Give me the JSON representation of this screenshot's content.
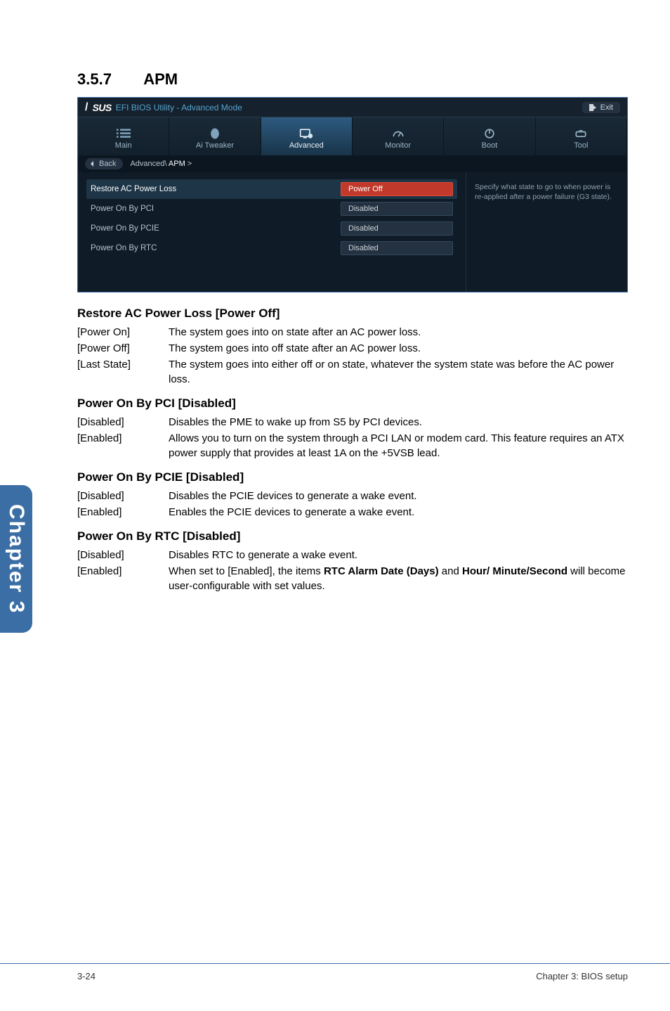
{
  "section": {
    "number": "3.5.7",
    "title": "APM"
  },
  "bios": {
    "brand_text": "SUS",
    "title_mode": "EFI BIOS Utility - Advanced Mode",
    "exit_label": "Exit",
    "tabs": [
      {
        "label": "Main"
      },
      {
        "label": "Ai  Tweaker"
      },
      {
        "label": "Advanced"
      },
      {
        "label": "Monitor"
      },
      {
        "label": "Boot"
      },
      {
        "label": "Tool"
      }
    ],
    "back_label": "Back",
    "breadcrumb_prefix": "Advanced\\ ",
    "breadcrumb_bold": "APM",
    "breadcrumb_suffix": " >",
    "settings": [
      {
        "label": "Restore AC Power Loss",
        "value": "Power Off",
        "highlight": true
      },
      {
        "label": "Power On By PCI",
        "value": "Disabled",
        "highlight": false
      },
      {
        "label": "Power On By PCIE",
        "value": "Disabled",
        "highlight": false
      },
      {
        "label": "Power On By RTC",
        "value": "Disabled",
        "highlight": false
      }
    ],
    "help_text": "Specify what state to go to when power is re-applied after a power failure (G3 state)."
  },
  "doc": {
    "items": [
      {
        "heading": "Restore AC Power Loss [Power Off]",
        "rows": [
          {
            "term": "[Power On]",
            "desc": "The system goes into on state after an AC power loss."
          },
          {
            "term": "[Power Off]",
            "desc": "The system goes into off state after an AC power loss."
          },
          {
            "term": "[Last State]",
            "desc": "The system goes into either off or on state, whatever the system state was before the AC power loss."
          }
        ]
      },
      {
        "heading": "Power On By PCI [Disabled]",
        "rows": [
          {
            "term": "[Disabled]",
            "desc": "Disables the PME to wake up from S5 by PCI devices."
          },
          {
            "term": "[Enabled]",
            "desc": "Allows you to turn on the system through a PCI LAN or modem card. This feature requires an ATX power supply that provides at least 1A on the +5VSB lead."
          }
        ]
      },
      {
        "heading": "Power On By PCIE [Disabled]",
        "rows": [
          {
            "term": "[Disabled]",
            "desc": "Disables the PCIE devices to generate a wake event."
          },
          {
            "term": "[Enabled]",
            "desc": "Enables the PCIE devices to generate a wake event."
          }
        ]
      },
      {
        "heading": "Power On By RTC [Disabled]",
        "rows": [
          {
            "term": "[Disabled]",
            "desc": "Disables RTC to generate a wake event."
          },
          {
            "term": "[Enabled]",
            "desc_html": "When set to [Enabled], the items <b>RTC Alarm Date (Days)</b> and <b>Hour/ Minute/Second</b> will become user-configurable with set values."
          }
        ]
      }
    ]
  },
  "sidebar": {
    "label": "Chapter 3"
  },
  "footer": {
    "left": "3-24",
    "right": "Chapter 3: BIOS setup"
  }
}
